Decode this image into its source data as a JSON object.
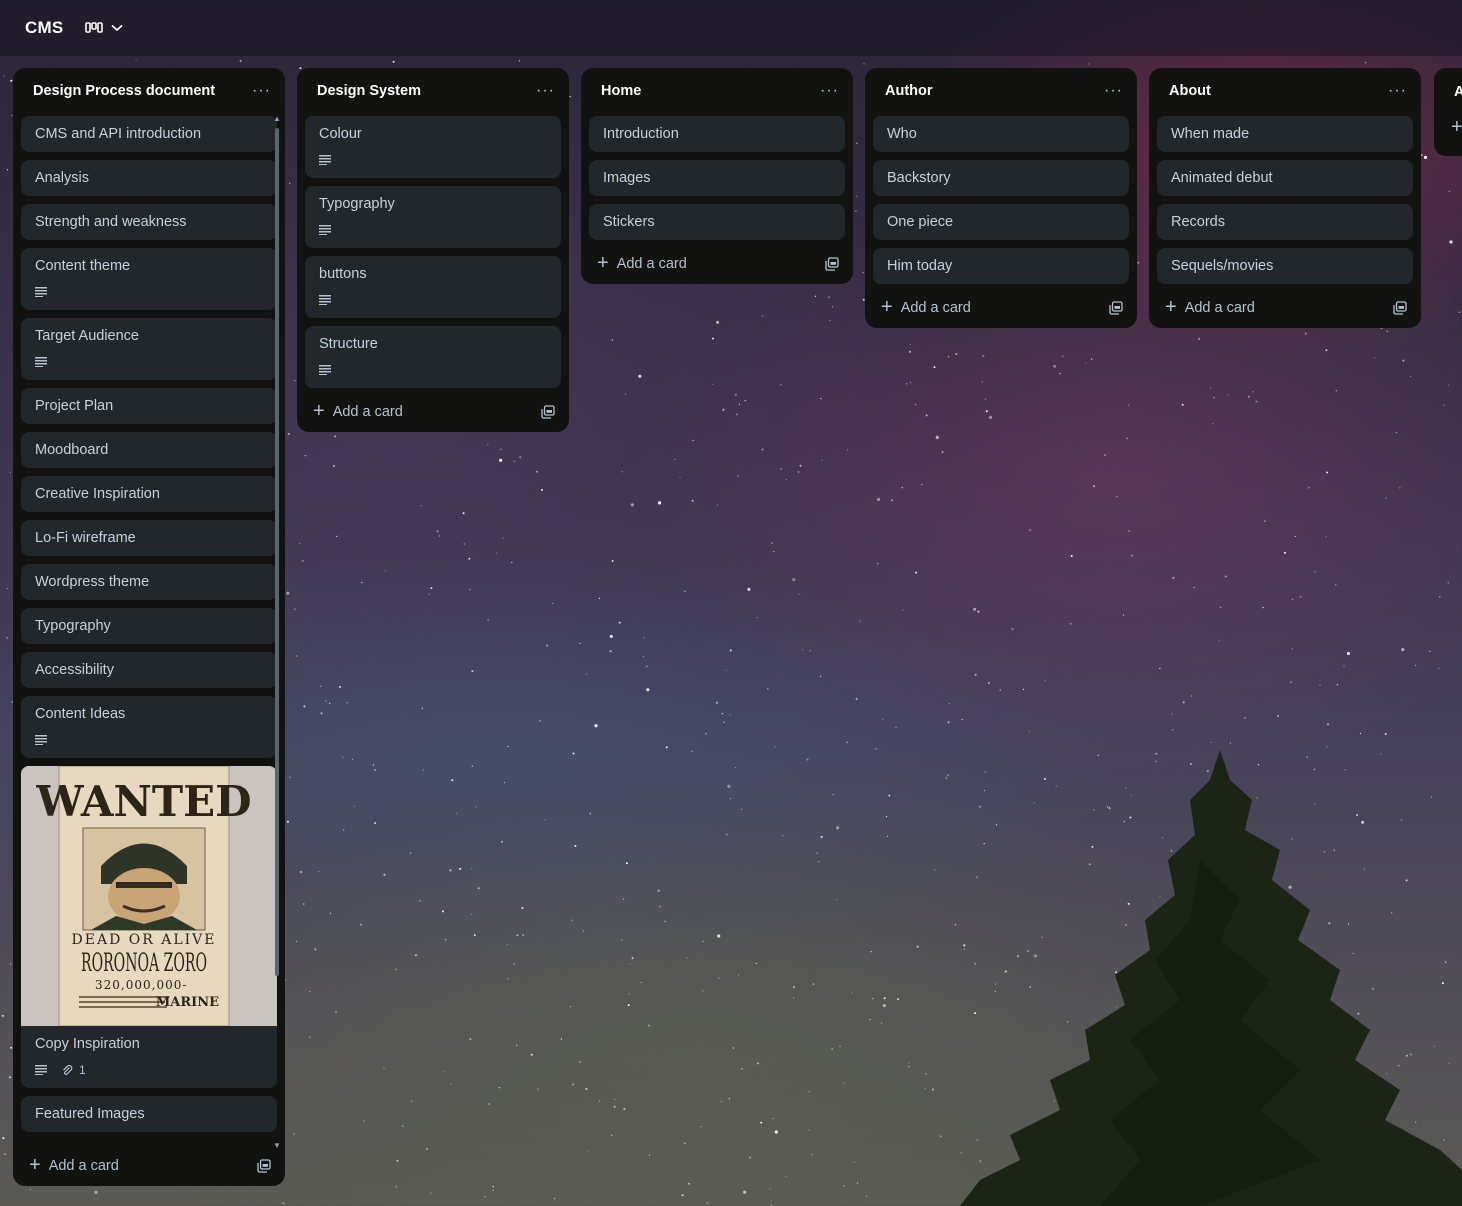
{
  "board": {
    "title": "CMS"
  },
  "colors": {
    "list_bg": "#121310",
    "card_bg": "#22272b",
    "text": "#b6c2cf"
  },
  "lists": [
    {
      "title": "Design Process document",
      "cards": [
        {
          "label": "CMS and API introduction"
        },
        {
          "label": "Analysis"
        },
        {
          "label": "Strength and weakness"
        },
        {
          "label": "Content theme",
          "has_description": true
        },
        {
          "label": "Target Audience",
          "has_description": true
        },
        {
          "label": "Project Plan"
        },
        {
          "label": "Moodboard"
        },
        {
          "label": "Creative Inspiration"
        },
        {
          "label": "Lo-Fi wireframe"
        },
        {
          "label": "Wordpress theme"
        },
        {
          "label": "Typography"
        },
        {
          "label": "Accessibility"
        },
        {
          "label": "Content Ideas",
          "has_description": true
        },
        {
          "label": "Copy Inspiration",
          "has_description": true,
          "attachments": "1",
          "cover": {
            "heading": "WANTED",
            "subheading": "DEAD OR ALIVE",
            "name": "RORONOA ZORO",
            "bounty": "320,000,000-",
            "issuer": "MARINE"
          }
        },
        {
          "label": "Featured Images"
        }
      ],
      "add_label": "Add a card"
    },
    {
      "title": "Design System",
      "cards": [
        {
          "label": "Colour",
          "has_description": true
        },
        {
          "label": "Typography",
          "has_description": true
        },
        {
          "label": "buttons",
          "has_description": true
        },
        {
          "label": "Structure",
          "has_description": true
        }
      ],
      "add_label": "Add a card"
    },
    {
      "title": "Home",
      "cards": [
        {
          "label": "Introduction"
        },
        {
          "label": "Images"
        },
        {
          "label": "Stickers"
        }
      ],
      "add_label": "Add a card"
    },
    {
      "title": "Author",
      "cards": [
        {
          "label": "Who"
        },
        {
          "label": "Backstory"
        },
        {
          "label": "One piece"
        },
        {
          "label": "Him today"
        }
      ],
      "add_label": "Add a card"
    },
    {
      "title": "About",
      "cards": [
        {
          "label": "When made"
        },
        {
          "label": "Animated debut"
        },
        {
          "label": "Records"
        },
        {
          "label": "Sequels/movies"
        }
      ],
      "add_label": "Add a card"
    }
  ],
  "partial_list": {
    "title_initial": "A"
  }
}
